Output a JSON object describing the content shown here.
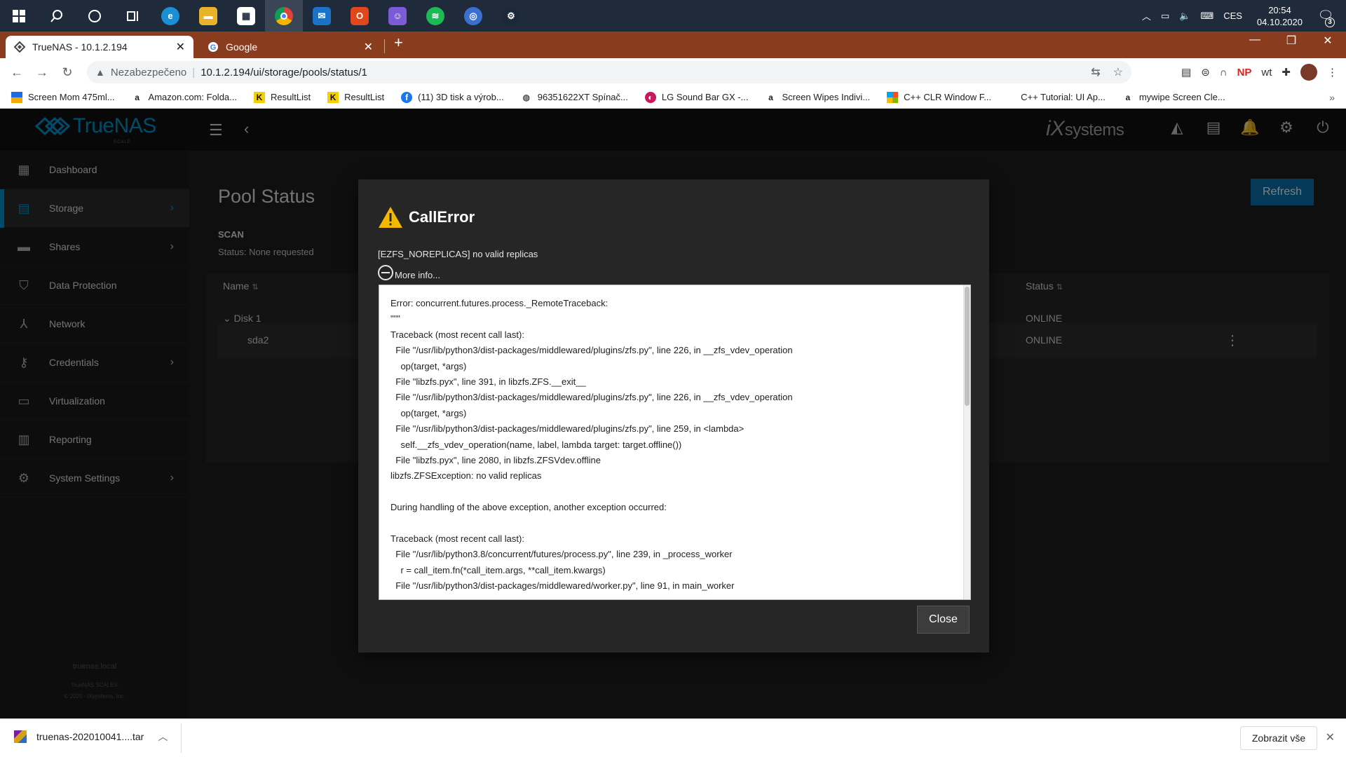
{
  "taskbar": {
    "tray_lang": "CES",
    "time": "20:54",
    "date": "04.10.2020",
    "notifications": "3"
  },
  "browser": {
    "tabs": [
      {
        "title": "TrueNAS - 10.1.2.194"
      },
      {
        "title": "Google"
      }
    ],
    "address": {
      "security_label": "Nezabezpečeno",
      "url": "10.1.2.194/ui/storage/pools/status/1"
    },
    "extensions": {
      "np_label": "NP",
      "wt_label": "wt"
    },
    "bookmarks": [
      {
        "label": "Screen Mom 475ml..."
      },
      {
        "label": "Amazon.com: Folda..."
      },
      {
        "label": "ResultList"
      },
      {
        "label": "ResultList"
      },
      {
        "label": "(11) 3D tisk a výrob..."
      },
      {
        "label": "96351622XT Spínač..."
      },
      {
        "label": "LG Sound Bar GX -..."
      },
      {
        "label": "Screen Wipes Indivi..."
      },
      {
        "label": "C++ CLR Window F..."
      },
      {
        "label": "C++ Tutorial: UI Ap..."
      },
      {
        "label": "mywipe Screen Cle..."
      }
    ]
  },
  "truenas": {
    "brand": "TrueNAS",
    "brand_sub": "SCALE",
    "vendor_main": "iX",
    "vendor_rest": "systems",
    "sidebar": [
      {
        "label": "Dashboard"
      },
      {
        "label": "Storage"
      },
      {
        "label": "Shares"
      },
      {
        "label": "Data Protection"
      },
      {
        "label": "Network"
      },
      {
        "label": "Credentials"
      },
      {
        "label": "Virtualization"
      },
      {
        "label": "Reporting"
      },
      {
        "label": "System Settings"
      }
    ],
    "footer": {
      "hostname": "truenas.local",
      "product": "TrueNAS SCALE®",
      "copyright": "© 2020 - iXsystems, Inc."
    },
    "page": {
      "title": "Pool Status",
      "refresh_label": "Refresh",
      "scan_heading": "SCAN",
      "scan_status": "Status: None requested",
      "columns": {
        "name": "Name",
        "status": "Status"
      },
      "rows": [
        {
          "name": "Disk 1",
          "status": "ONLINE"
        },
        {
          "name": "sda2",
          "status": "ONLINE"
        }
      ]
    }
  },
  "dialog": {
    "title": "CallError",
    "message": "[EZFS_NOREPLICAS] no valid replicas",
    "more_info": "More info...",
    "trace": [
      "Error: concurrent.futures.process._RemoteTraceback:",
      "\"\"\"",
      "Traceback (most recent call last):",
      "  File \"/usr/lib/python3/dist-packages/middlewared/plugins/zfs.py\", line 226, in __zfs_vdev_operation",
      "    op(target, *args)",
      "  File \"libzfs.pyx\", line 391, in libzfs.ZFS.__exit__",
      "  File \"/usr/lib/python3/dist-packages/middlewared/plugins/zfs.py\", line 226, in __zfs_vdev_operation",
      "    op(target, *args)",
      "  File \"/usr/lib/python3/dist-packages/middlewared/plugins/zfs.py\", line 259, in <lambda>",
      "    self.__zfs_vdev_operation(name, label, lambda target: target.offline())",
      "  File \"libzfs.pyx\", line 2080, in libzfs.ZFSVdev.offline",
      "libzfs.ZFSException: no valid replicas",
      "",
      "During handling of the above exception, another exception occurred:",
      "",
      "Traceback (most recent call last):",
      "  File \"/usr/lib/python3.8/concurrent/futures/process.py\", line 239, in _process_worker",
      "    r = call_item.fn(*call_item.args, **call_item.kwargs)",
      "  File \"/usr/lib/python3/dist-packages/middlewared/worker.py\", line 91, in main_worker"
    ],
    "close_label": "Close"
  },
  "downloads": {
    "file": "truenas-202010041....tar",
    "show_all": "Zobrazit vše"
  },
  "colors": {
    "accent": "#0095d5",
    "refresh_button": "#0b72b0",
    "warning": "#f5b800",
    "tabstrip": "#8a3c1e"
  }
}
